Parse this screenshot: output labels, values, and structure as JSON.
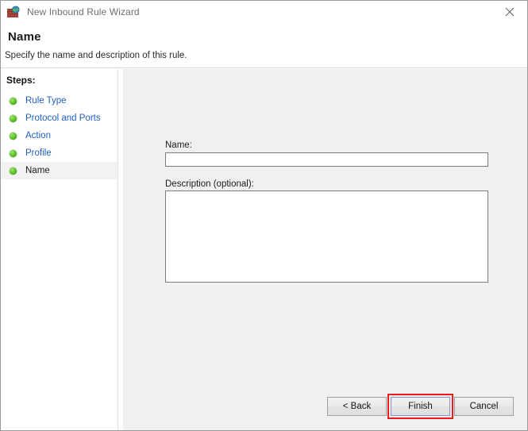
{
  "window": {
    "title": "New Inbound Rule Wizard",
    "icon": "firewall-globe-icon",
    "close_label": "×"
  },
  "header": {
    "title": "Name",
    "subtitle": "Specify the name and description of this rule."
  },
  "sidebar": {
    "label": "Steps:",
    "items": [
      {
        "label": "Rule Type",
        "state": "completed"
      },
      {
        "label": "Protocol and Ports",
        "state": "completed"
      },
      {
        "label": "Action",
        "state": "completed"
      },
      {
        "label": "Profile",
        "state": "completed"
      },
      {
        "label": "Name",
        "state": "current"
      }
    ]
  },
  "main": {
    "name_label": "Name:",
    "name_value": "",
    "name_placeholder": "",
    "description_label": "Description (optional):",
    "description_value": "",
    "description_placeholder": ""
  },
  "buttons": {
    "back": "< Back",
    "finish": "Finish",
    "cancel": "Cancel"
  },
  "colors": {
    "link": "#1f5fbf",
    "bullet_green": "#63c62c",
    "panel_bg": "#f0f0f0",
    "highlight_red": "#ee1c1c",
    "border_gray": "#9a9a9a"
  }
}
